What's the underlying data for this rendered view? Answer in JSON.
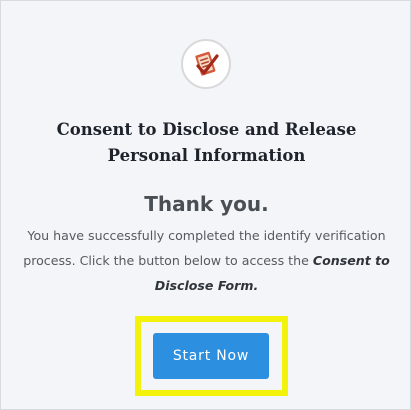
{
  "logo": {
    "icon": "checklist-icon",
    "accent": "#c0392b"
  },
  "form": {
    "title": "Consent to Disclose and Release Personal Information",
    "heading": "Thank you.",
    "message_before": "You have successfully completed the identify verification process. Click the button below to access the ",
    "message_link": "Consent to Disclose Form.",
    "button_label": "Start Now"
  },
  "colors": {
    "button": "#2c8fe0",
    "highlight": "#f2f20b"
  }
}
